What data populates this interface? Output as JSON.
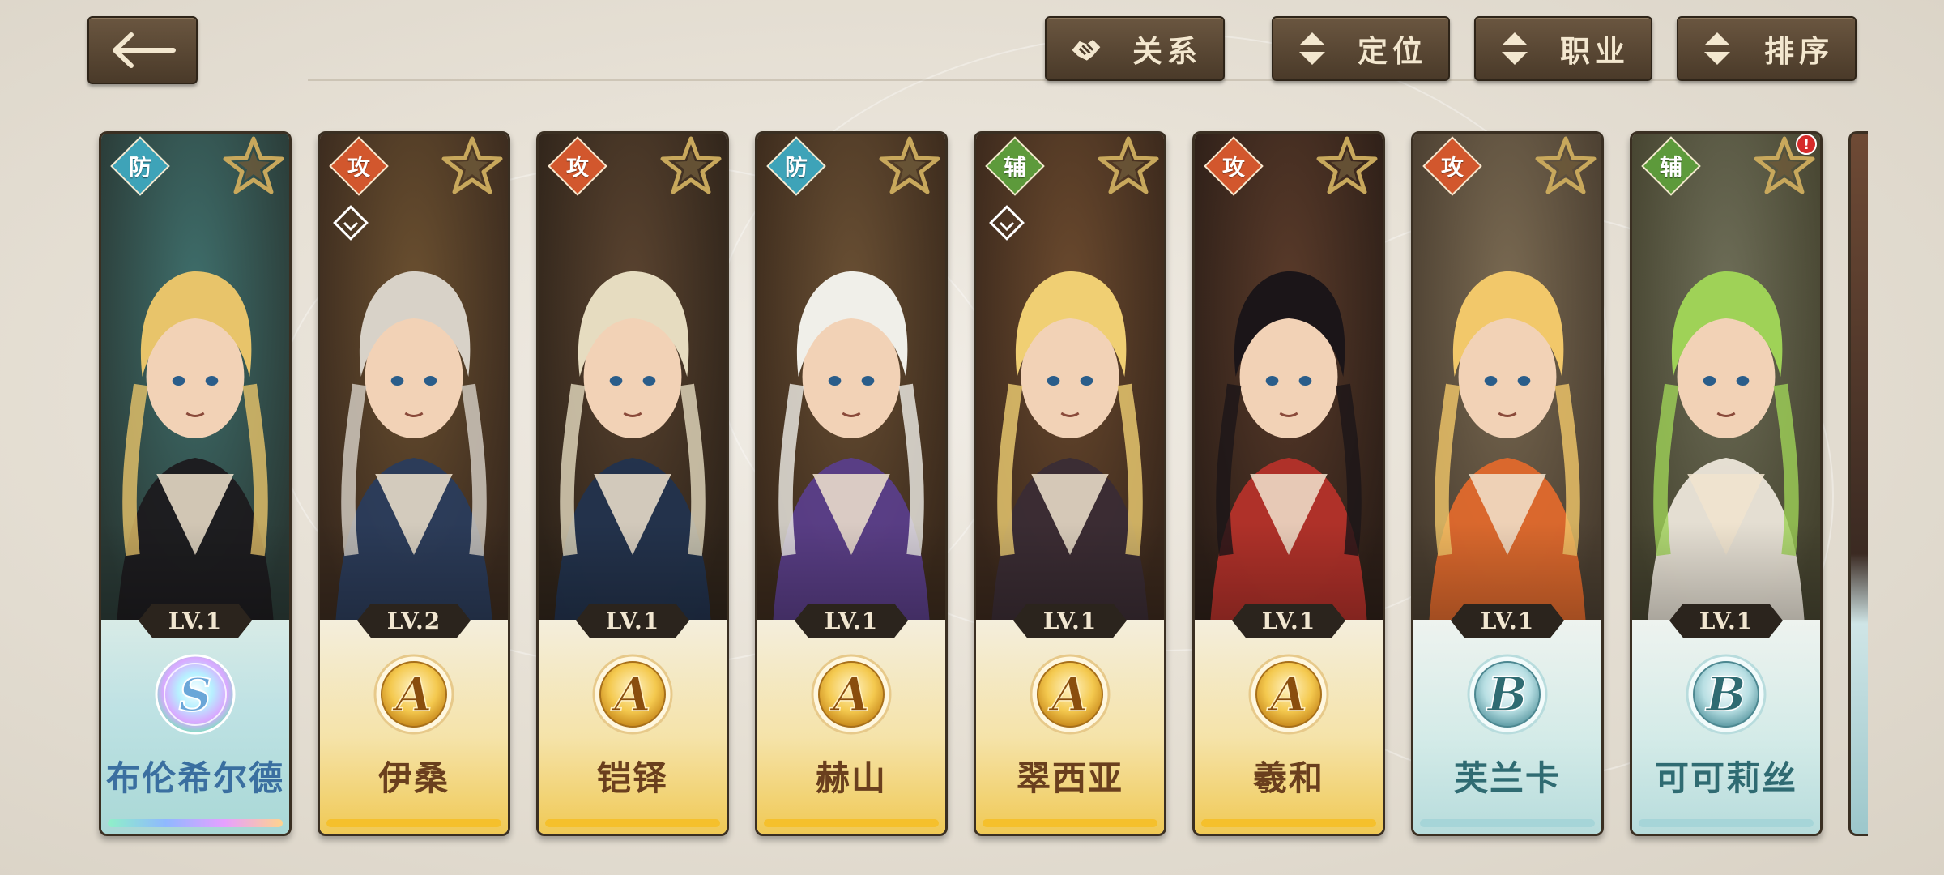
{
  "header": {
    "back_icon": "back-arrow-icon",
    "buttons": [
      {
        "label": "关系",
        "icon": "handshake-icon"
      },
      {
        "label": "定位",
        "icon": "sort-arrows-icon"
      },
      {
        "label": "职业",
        "icon": "sort-arrows-icon"
      },
      {
        "label": "排序",
        "icon": "sort-arrows-icon"
      }
    ]
  },
  "characters": [
    {
      "name": "布伦希尔德",
      "role": "防",
      "level": "LV.1",
      "rank": "S",
      "linked": false,
      "alert": false
    },
    {
      "name": "伊桑",
      "role": "攻",
      "level": "LV.2",
      "rank": "A",
      "linked": true,
      "alert": false
    },
    {
      "name": "铠铎",
      "role": "攻",
      "level": "LV.1",
      "rank": "A",
      "linked": false,
      "alert": false
    },
    {
      "name": "赫山",
      "role": "防",
      "level": "LV.1",
      "rank": "A",
      "linked": false,
      "alert": false
    },
    {
      "name": "翠西亚",
      "role": "辅",
      "level": "LV.1",
      "rank": "A",
      "linked": true,
      "alert": false
    },
    {
      "name": "羲和",
      "role": "攻",
      "level": "LV.1",
      "rank": "A",
      "linked": false,
      "alert": false
    },
    {
      "name": "芙兰卡",
      "role": "攻",
      "level": "LV.1",
      "rank": "B",
      "linked": false,
      "alert": false
    },
    {
      "name": "可可莉丝",
      "role": "辅",
      "level": "LV.1",
      "rank": "B",
      "linked": false,
      "alert": true,
      "alert_text": "!"
    }
  ],
  "colors": {
    "role_defense": "#3ea3b8",
    "role_attack": "#d2572d",
    "role_support": "#5d9a3b",
    "rank_a_name": "#6a3f1e",
    "rank_b_name": "#2f6b72",
    "rank_s_name": "#3a6fa0"
  }
}
